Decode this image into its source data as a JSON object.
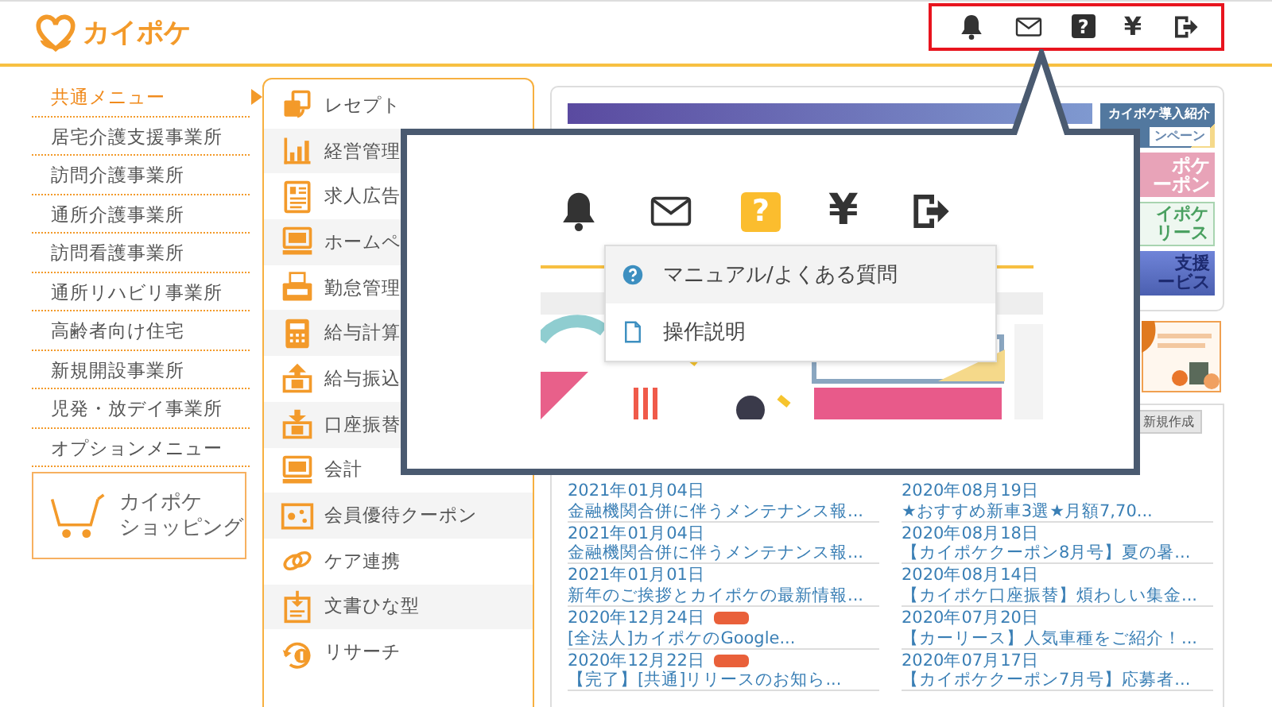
{
  "header": {
    "logo": "カイポケ",
    "icons": [
      {
        "kind": "bell"
      },
      {
        "kind": "mail"
      },
      {
        "kind": "help",
        "glyph": "?"
      },
      {
        "kind": "yen",
        "glyph": "¥"
      },
      {
        "kind": "logout"
      }
    ]
  },
  "sidebar": {
    "items": [
      {
        "label": "共通メニュー",
        "selected": true
      },
      {
        "label": "居宅介護支援事業所",
        "selected": false
      },
      {
        "label": "訪問介護事業所",
        "selected": false
      },
      {
        "label": "通所介護事業所",
        "selected": false
      },
      {
        "label": "訪問看護事業所",
        "selected": false
      },
      {
        "label": "通所リハビリ事業所",
        "selected": false
      },
      {
        "label": "高齢者向け住宅",
        "selected": false
      },
      {
        "label": "新規開設事業所",
        "selected": false
      },
      {
        "label": "児発・放デイ事業所",
        "selected": false
      },
      {
        "label": "オプションメニュー",
        "selected": false
      }
    ],
    "shopping": {
      "lines": [
        "カイポケ",
        "ショッピング"
      ]
    }
  },
  "menu": {
    "items": [
      {
        "label": "レセプト"
      },
      {
        "label": "経営管理"
      },
      {
        "label": "求人広告"
      },
      {
        "label": "ホームペ"
      },
      {
        "label": "勤怠管理"
      },
      {
        "label": "給与計算"
      },
      {
        "label": "給与振込"
      },
      {
        "label": "口座振替"
      },
      {
        "label": "会計"
      },
      {
        "label": "会員優待クーポン"
      },
      {
        "label": "ケア連携"
      },
      {
        "label": "文書ひな型"
      },
      {
        "label": "リサーチ"
      }
    ]
  },
  "banners": [
    {
      "kind": "intro",
      "lines": [
        "カイポケ導入紹介",
        "ンペーン"
      ]
    },
    {
      "kind": "coupon",
      "lines": [
        "ポケ",
        "ーポン"
      ]
    },
    {
      "kind": "lease",
      "lines": [
        "イポケ",
        "リース"
      ]
    },
    {
      "kind": "support",
      "lines": [
        "支援",
        "ービス"
      ]
    }
  ],
  "new_button": "新規作成",
  "news": {
    "columns": [
      [
        {
          "date": "2021年01月04日",
          "title": "金融機関合併に伴うメンテナンス報...",
          "badge": false
        },
        {
          "date": "2021年01月04日",
          "title": "金融機関合併に伴うメンテナンス報...",
          "badge": false
        },
        {
          "date": "2021年01月01日",
          "title": "新年のご挨拶とカイポケの最新情報...",
          "badge": false
        },
        {
          "date": "2020年12月24日",
          "title": "[全法人]カイポケのGoogle...",
          "badge": true
        },
        {
          "date": "2020年12月22日",
          "title": "【完了】[共通]リリースのお知ら...",
          "badge": true
        }
      ],
      [
        {
          "date": "2020年08月19日",
          "title": "★おすすめ新車3選★月額7,70...",
          "badge": false
        },
        {
          "date": "2020年08月18日",
          "title": "【カイポケクーポン8月号】夏の暑...",
          "badge": false
        },
        {
          "date": "2020年08月14日",
          "title": "【カイポケ口座振替】煩わしい集金...",
          "badge": false
        },
        {
          "date": "2020年07月20日",
          "title": "【カーリース】人気車種をご紹介！...",
          "badge": false
        },
        {
          "date": "2020年07月17日",
          "title": "【カイポケクーポン7月号】応募者...",
          "badge": false
        }
      ]
    ]
  },
  "callout": {
    "icons": [
      {
        "kind": "bell",
        "selected": false
      },
      {
        "kind": "mail",
        "selected": false
      },
      {
        "kind": "help",
        "glyph": "?",
        "selected": true
      },
      {
        "kind": "yen",
        "glyph": "¥",
        "selected": false
      },
      {
        "kind": "logout",
        "selected": false
      }
    ],
    "dropdown": [
      {
        "label": "マニュアル/よくある質問",
        "highlighted": true
      },
      {
        "label": "操作説明",
        "highlighted": false
      }
    ]
  }
}
